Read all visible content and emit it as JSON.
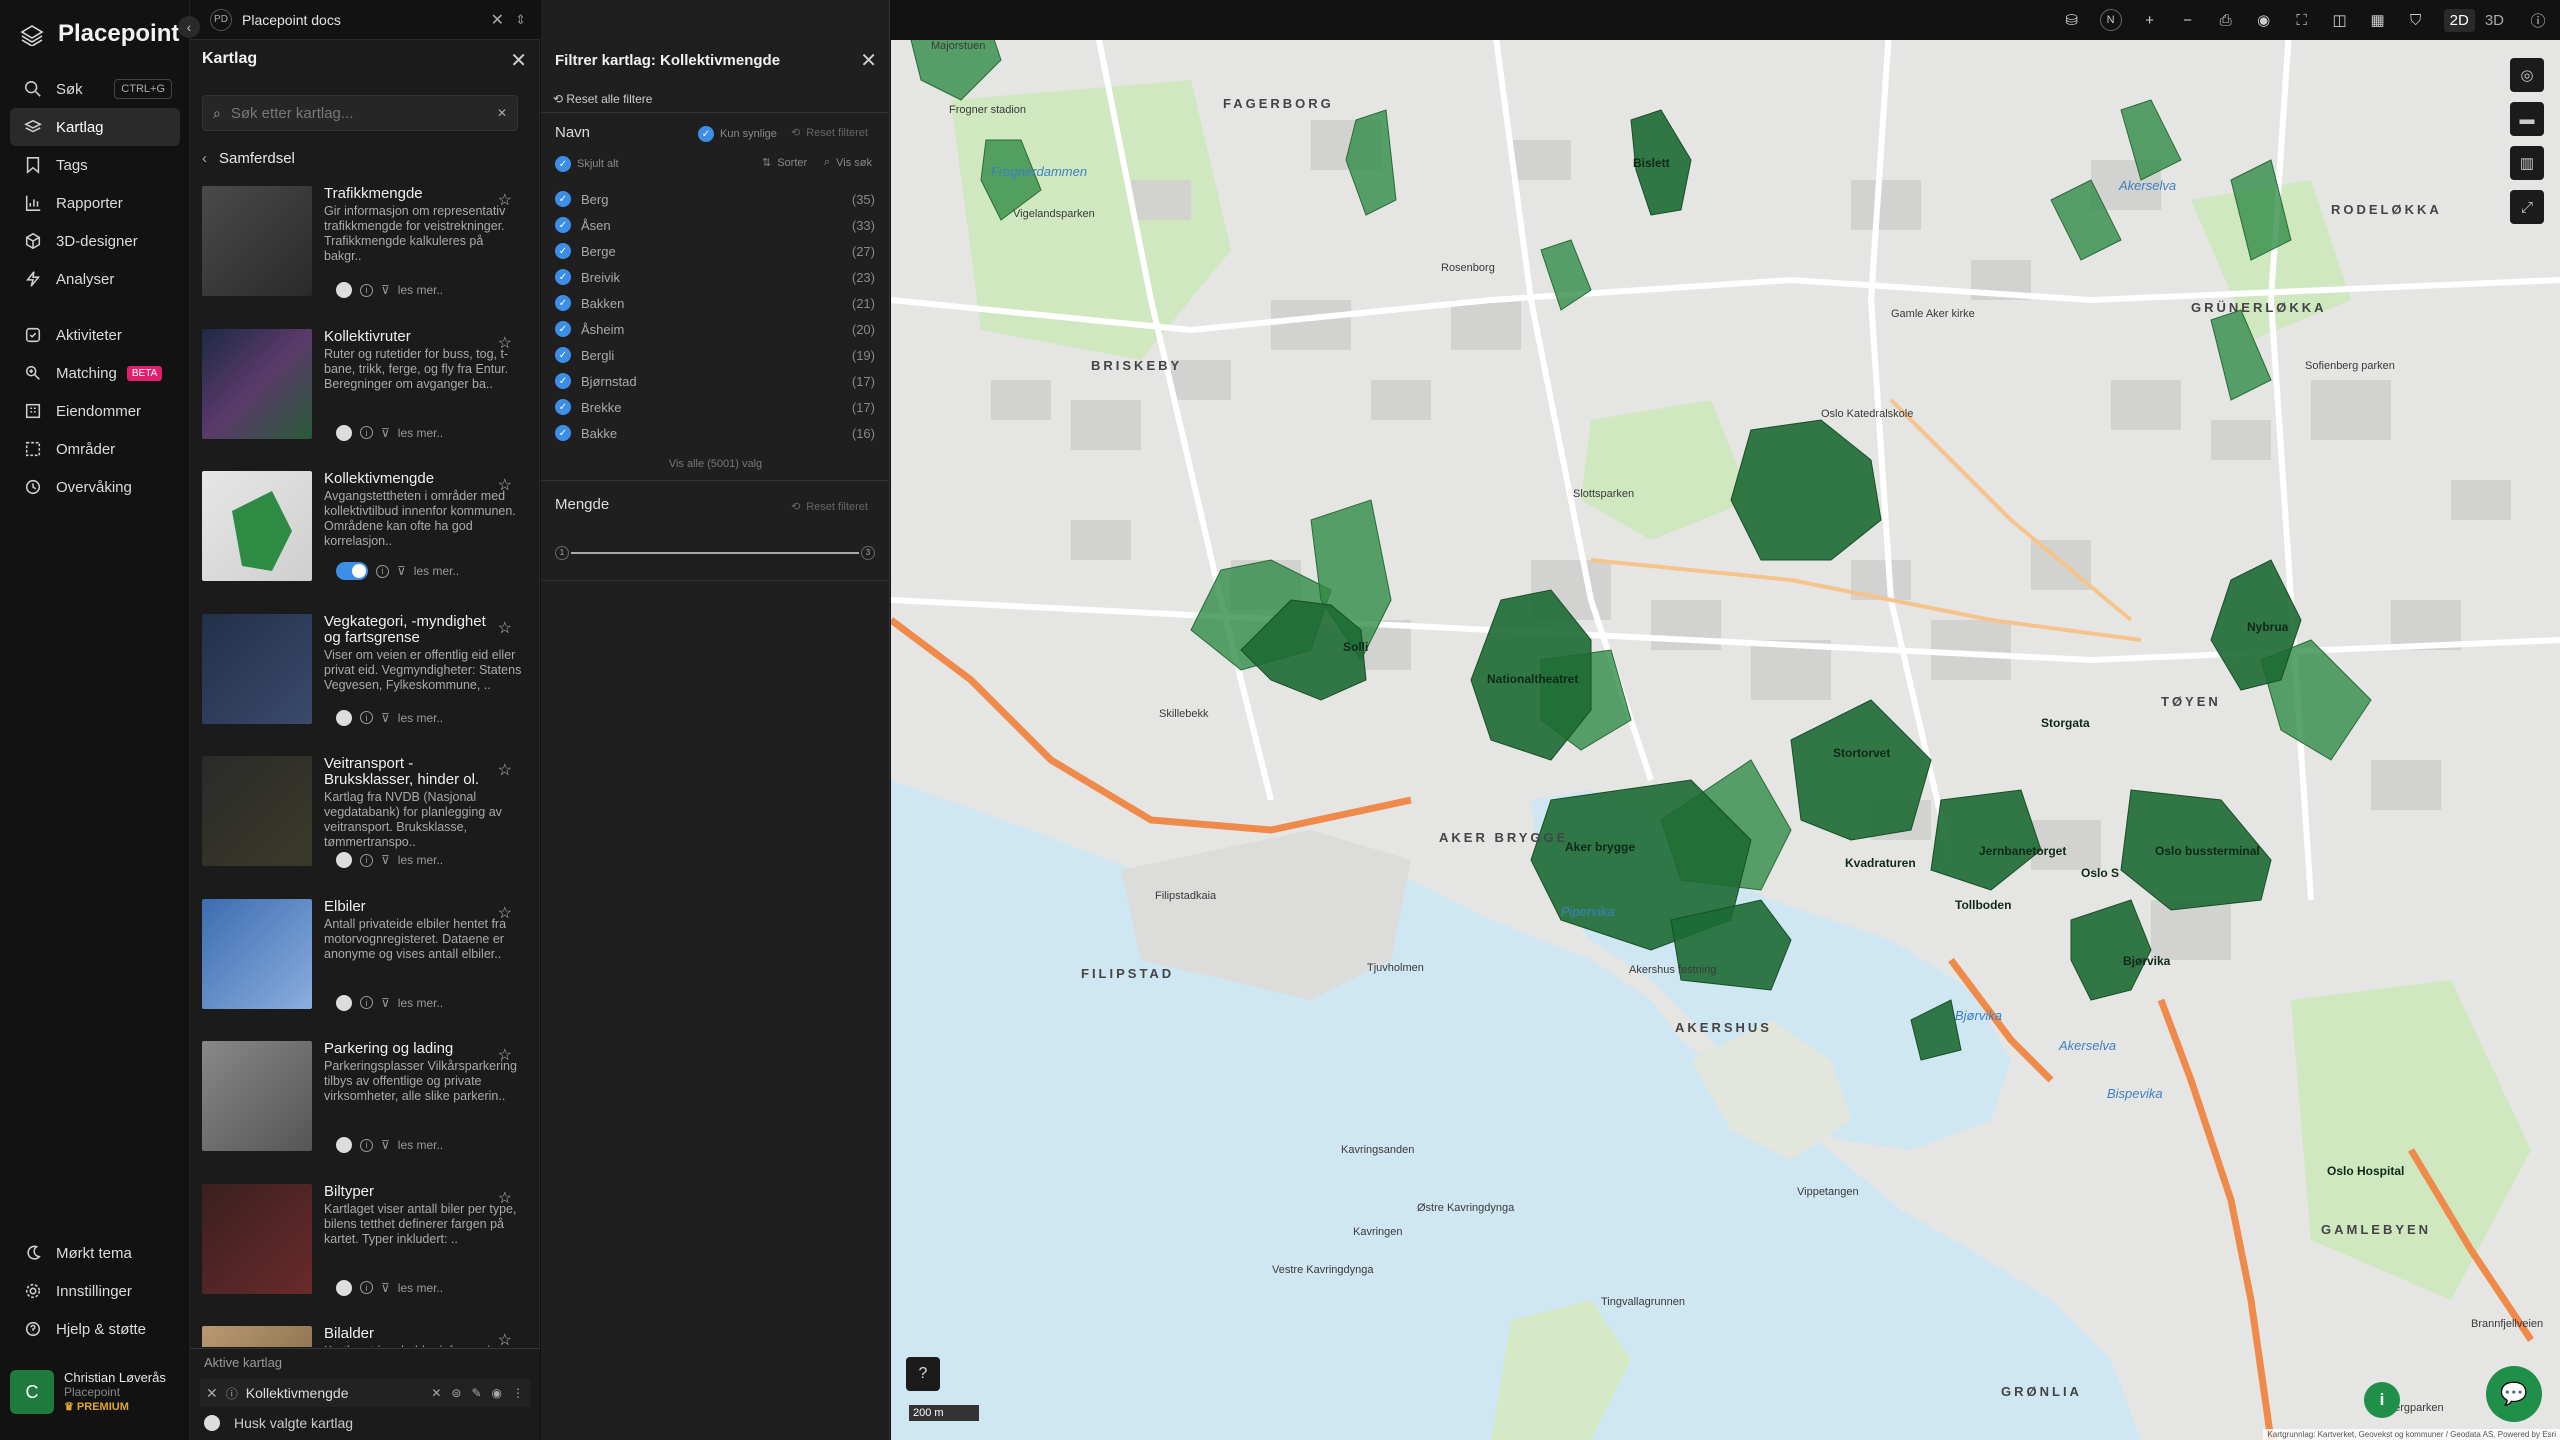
{
  "app": {
    "name": "Placepoint",
    "tab_title": "Placepoint docs",
    "tab_icon_text": "PD"
  },
  "nav": {
    "search_label": "Søk",
    "search_kbd": "CTRL+G",
    "items": [
      {
        "label": "Kartlag",
        "icon": "layers-icon"
      },
      {
        "label": "Tags",
        "icon": "tag-icon"
      },
      {
        "label": "Rapporter",
        "icon": "chart-icon"
      },
      {
        "label": "3D-designer",
        "icon": "cube-icon"
      },
      {
        "label": "Analyser",
        "icon": "bolt-icon"
      }
    ],
    "items2": [
      {
        "label": "Aktiviteter",
        "icon": "activity-icon"
      },
      {
        "label": "Matching",
        "icon": "match-icon",
        "badge": "BETA"
      },
      {
        "label": "Eiendommer",
        "icon": "building-icon"
      },
      {
        "label": "Områder",
        "icon": "area-icon"
      },
      {
        "label": "Overvåking",
        "icon": "monitor-icon"
      }
    ],
    "bottom": [
      {
        "label": "Mørkt tema",
        "icon": "moon-icon"
      },
      {
        "label": "Innstillinger",
        "icon": "gear-icon"
      },
      {
        "label": "Hjelp & støtte",
        "icon": "help-icon"
      }
    ]
  },
  "user": {
    "initial": "C",
    "name": "Christian Løverås",
    "org": "Placepoint",
    "plan": "PREMIUM"
  },
  "layers_panel": {
    "title": "Kartlag",
    "search_placeholder": "Søk etter kartlag...",
    "breadcrumb": "Samferdsel",
    "read_more": "les mer..",
    "layers": [
      {
        "title": "Trafikkmengde",
        "desc": "Gir informasjon om representativ trafikkmengde for veistrekninger. Trafikkmengde kalkuleres på bakgr..",
        "on": false
      },
      {
        "title": "Kollektivruter",
        "desc": "Ruter og rutetider for buss, tog, t-bane, trikk, ferge, og fly fra Entur. Beregninger om avganger ba..",
        "on": false
      },
      {
        "title": "Kollektivmengde",
        "desc": "Avgangstettheten i områder med kollektivtilbud innenfor kommunen. Områdene kan ofte ha god korrelasjon..",
        "on": true
      },
      {
        "title": "Vegkategori, -myndighet og fartsgrense",
        "desc": "Viser om veien er offentlig eid eller privat eid. Vegmyndigheter: Statens Vegvesen, Fylkeskommune, ..",
        "on": false
      },
      {
        "title": "Veitransport - Bruksklasser, hinder ol.",
        "desc": "Kartlag fra NVDB (Nasjonal vegdatabank) for planlegging av veitransport. Bruksklasse, tømmertranspo..",
        "on": false
      },
      {
        "title": "Elbiler",
        "desc": "Antall privateide elbiler hentet fra motorvognregisteret. Dataene er anonyme og vises antall elbiler..",
        "on": false
      },
      {
        "title": "Parkering og lading",
        "desc": "Parkeringsplasser Vilkårsparkering tilbys av offentlige og private virksomheter, alle slike parkerin..",
        "on": false
      },
      {
        "title": "Biltyper",
        "desc": "Kartlaget viser antall biler per type, bilens tetthet definerer fargen på kartet. Typer inkludert: ..",
        "on": false
      },
      {
        "title": "Bilalder",
        "desc": "Kartlaget inneholder informasjon om personbile..",
        "on": false
      }
    ],
    "active_heading": "Aktive kartlag",
    "active_layer": "Kollektivmengde",
    "hide_selected": "Husk valgte kartlag"
  },
  "filter_panel": {
    "title": "Filtrer kartlag: Kollektivmengde",
    "reset_all": "Reset alle filtere",
    "name_section": "Navn",
    "only_visible": "Kun synlige",
    "reset_filter": "Reset filteret",
    "hide_all": "Skjult alt",
    "sort": "Sorter",
    "show_search": "Vis søk",
    "rows": [
      {
        "name": "Berg",
        "count": "(35)"
      },
      {
        "name": "Åsen",
        "count": "(33)"
      },
      {
        "name": "Berge",
        "count": "(27)"
      },
      {
        "name": "Breivik",
        "count": "(23)"
      },
      {
        "name": "Bakken",
        "count": "(21)"
      },
      {
        "name": "Åsheim",
        "count": "(20)"
      },
      {
        "name": "Bergli",
        "count": "(19)"
      },
      {
        "name": "Bjørnstad",
        "count": "(17)"
      },
      {
        "name": "Brekke",
        "count": "(17)"
      },
      {
        "name": "Bakke",
        "count": "(16)"
      }
    ],
    "show_all": "Vis alle (5001) valg",
    "amount_section": "Mengde",
    "slider_min": "1",
    "slider_max": "3"
  },
  "map": {
    "modes": [
      "2D",
      "3D"
    ],
    "north": "N",
    "scale": "200 m",
    "attribution": "Kartgrunnlag: Kartverket, Geovekst og kommuner / Geodata AS. Powered by Esri",
    "districts": [
      "FAGERBORG",
      "BRISKEBY",
      "FILIPSTAD",
      "AKER BRYGGE",
      "AKERSHUS",
      "GRÜNERLØKKA",
      "RODELØKKA",
      "GAMLEBYEN",
      "GRØNLIA",
      "TØYEN"
    ],
    "water": [
      "Frognerdammen",
      "Akerselva",
      "Pipervika",
      "Akerselva",
      "Bispevika",
      "Bjørvika"
    ],
    "zones": [
      "Bislett",
      "Solli",
      "Nationaltheatret",
      "Jernbanetorget",
      "Oslo S",
      "Oslo bussterminal",
      "Nybrua",
      "Stortorvet",
      "Tollboden",
      "Aker brygge",
      "Bjørvika",
      "Storgata",
      "Oslo Hospital",
      "Kvadraturen"
    ],
    "streets": [
      "Vigelandsparken",
      "Frogner stadion",
      "Slottsparken",
      "Rosenborg",
      "Majorstuen",
      "Skillebekk",
      "Tjuvholmen",
      "Kavringen",
      "Vippetangen",
      "Kavringsanden",
      "Østre Kavringdynga",
      "Vestre Kavringdynga",
      "Tingvallagrunnen",
      "Ekebergparken",
      "Brannfjellveien",
      "Filipstadkaia",
      "Akershus festning",
      "Gamle Aker kirke",
      "Oslo Katedralskole",
      "Sofienberg parken"
    ]
  },
  "colors": {
    "accent": "#3d8ee6",
    "green": "#1f8f4a",
    "zone_fill": "#2e8b44",
    "zone_fill_dark": "#1d6a33",
    "sea": "#cfe6f3",
    "land": "#e6e6e6",
    "park": "#cfe8c0",
    "road_major": "#f08a4b"
  }
}
